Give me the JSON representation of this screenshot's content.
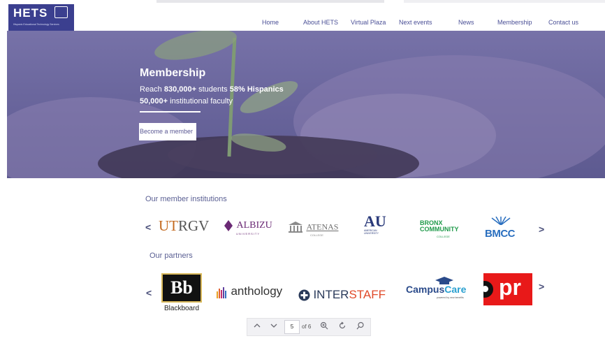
{
  "header": {
    "logo_text": "HETS",
    "logo_tagline": "Hispanic Educational Technology Services",
    "nav": [
      "Home",
      "About HETS",
      "Virtual Plaza",
      "Next events",
      "News",
      "Membership",
      "Contact us"
    ]
  },
  "hero": {
    "title": "Membership",
    "line1_prefix": "Reach ",
    "line1_bold1": "830,000+",
    "line1_mid": " students ",
    "line1_bold2": "58% Hispanics",
    "line2_bold": "50,000+",
    "line2_rest": " institutional faculty",
    "button": "Become a member"
  },
  "members": {
    "title": "Our member institutions",
    "prev": "<",
    "next": ">",
    "logos": {
      "utrgv_ut": "UT",
      "utrgv_rgv": "RGV",
      "albizu": "ALBIZU",
      "albizu_sub": "UNIVERSITY",
      "atenas": "ATENAS",
      "atenas_sub": "COLLEGE",
      "au": "AU",
      "au_sub": "AMERICAN UNIVERSITY",
      "bronx1": "BRONX",
      "bronx2": "COMMUNITY",
      "bronx3": "COLLEGE",
      "bmcc": "BMCC"
    }
  },
  "partners": {
    "title": "Our partners",
    "prev": "<",
    "next": ">",
    "logos": {
      "bb": "Bb",
      "blackboard": "Blackboard",
      "anthology": "anthology",
      "interstaff_inter": "INTER",
      "interstaff_staff": "STAFF",
      "campus": "Campus",
      "care": "Care",
      "campus_sub": "powered by new benefits",
      "opr": "pr"
    }
  },
  "viewer": {
    "page": "5",
    "of_label": "of 6"
  },
  "colors": {
    "brand": "#3b3f8f",
    "nav": "#4a4f96",
    "hero_overlay": "#6a669d"
  }
}
